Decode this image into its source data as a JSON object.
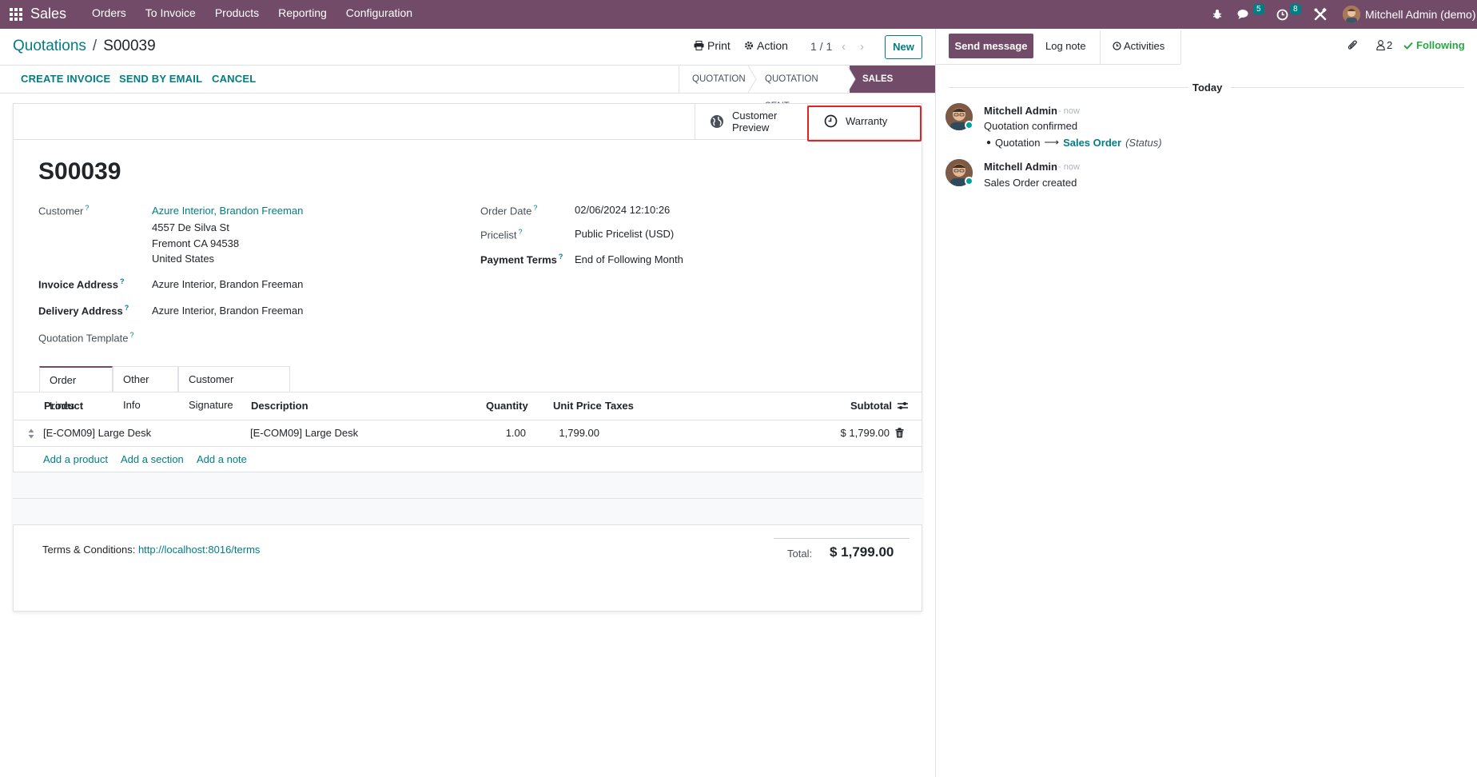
{
  "navbar": {
    "app_name": "Sales",
    "menu": [
      "Orders",
      "To Invoice",
      "Products",
      "Reporting",
      "Configuration"
    ],
    "messages_count": "5",
    "activities_count": "8",
    "user": "Mitchell Admin (demo)"
  },
  "control_panel": {
    "breadcrumb_parent": "Quotations",
    "breadcrumb_sep": "/",
    "breadcrumb_current": "S00039",
    "print_label": "Print",
    "action_label": "Action",
    "pager": "1 / 1",
    "new_label": "New"
  },
  "statusbar": {
    "actions": [
      "CREATE INVOICE",
      "SEND BY EMAIL",
      "CANCEL"
    ],
    "stages": [
      "QUOTATION",
      "QUOTATION SENT",
      "SALES ORDER"
    ],
    "active_stage": "SALES ORDER"
  },
  "smart_buttons": {
    "customer_preview_line1": "Customer",
    "customer_preview_line2": "Preview",
    "warranty": "Warranty"
  },
  "form": {
    "name": "S00039",
    "customer_label": "Customer",
    "customer_name": "Azure Interior, Brandon Freeman",
    "customer_street": "4557 De Silva St",
    "customer_city": "Fremont CA 94538",
    "customer_country": "United States",
    "invoice_address_label": "Invoice Address",
    "invoice_address": "Azure Interior, Brandon Freeman",
    "delivery_address_label": "Delivery Address",
    "delivery_address": "Azure Interior, Brandon Freeman",
    "quotation_template_label": "Quotation Template",
    "order_date_label": "Order Date",
    "order_date": "02/06/2024 12:10:26",
    "pricelist_label": "Pricelist",
    "pricelist": "Public Pricelist (USD)",
    "payment_terms_label": "Payment Terms",
    "payment_terms": "End of Following Month",
    "help_mark": "?"
  },
  "tabs": [
    "Order Lines",
    "Other Info",
    "Customer Signature"
  ],
  "order_lines": {
    "headers": {
      "product": "Product",
      "description": "Description",
      "quantity": "Quantity",
      "unit_price": "Unit Price",
      "taxes": "Taxes",
      "subtotal": "Subtotal"
    },
    "rows": [
      {
        "product": "[E-COM09] Large Desk",
        "description": "[E-COM09] Large Desk",
        "quantity": "1.00",
        "unit_price": "1,799.00",
        "taxes": "",
        "subtotal": "$ 1,799.00"
      }
    ],
    "add_product": "Add a product",
    "add_section": "Add a section",
    "add_note": "Add a note"
  },
  "footer": {
    "terms_label": "Terms & Conditions:",
    "terms_link": "http://localhost:8016/terms",
    "total_label": "Total:",
    "total_value": "$ 1,799.00"
  },
  "chatter": {
    "send_message": "Send message",
    "log_note": "Log note",
    "activities": "Activities",
    "followers_count": "2",
    "following": "Following",
    "date_separator": "Today",
    "messages": [
      {
        "author": "Mitchell Admin",
        "time": "- now",
        "text": "Quotation confirmed",
        "tracking_old": "Quotation",
        "tracking_new": "Sales Order",
        "tracking_field": "(Status)"
      },
      {
        "author": "Mitchell Admin",
        "time": "- now",
        "text": "Sales Order created"
      }
    ]
  },
  "colors": {
    "brand": "#714b67",
    "link": "#017e84",
    "highlight_border": "#e02424",
    "following": "#28a745"
  }
}
